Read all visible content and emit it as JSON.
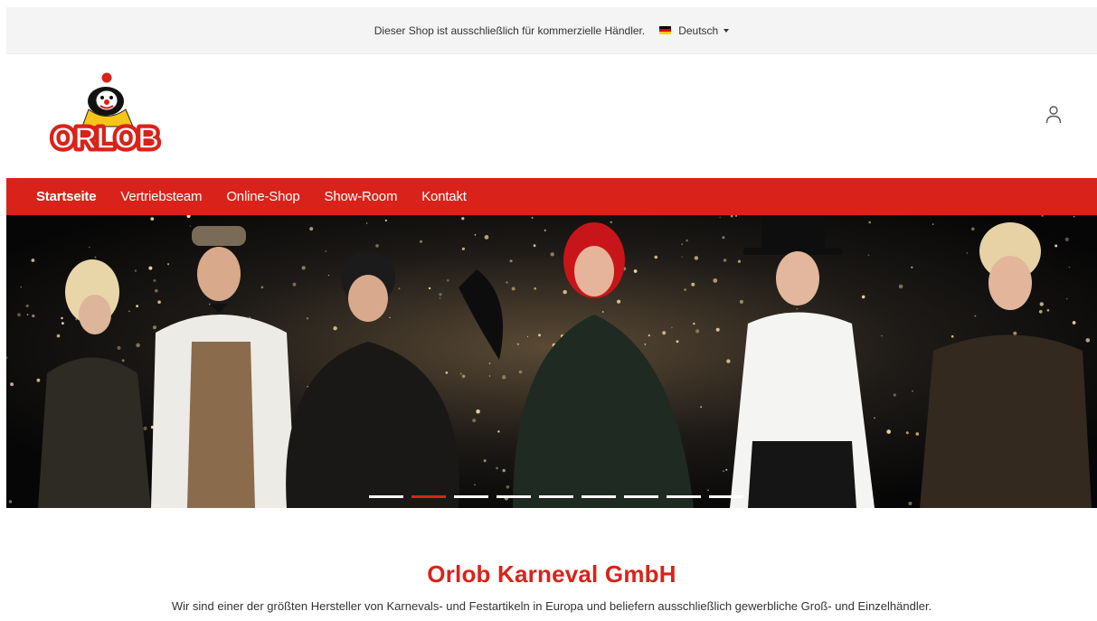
{
  "topbar": {
    "notice": "Dieser Shop ist ausschließlich für kommerzielle Händler.",
    "language": "Deutsch",
    "flag_colors": [
      "#000000",
      "#dd0000",
      "#ffce00"
    ]
  },
  "logo": {
    "text": "ORLOB",
    "icon": "clown-logo-icon"
  },
  "header": {
    "account_icon": "user-account-icon"
  },
  "nav": {
    "items": [
      {
        "label": "Startseite",
        "active": true
      },
      {
        "label": "Vertriebsteam",
        "active": false
      },
      {
        "label": "Online-Shop",
        "active": false
      },
      {
        "label": "Show-Room",
        "active": false
      },
      {
        "label": "Kontakt",
        "active": false
      }
    ]
  },
  "hero": {
    "slide_count": 9,
    "active_slide": 2
  },
  "intro": {
    "title": "Orlob Karneval GmbH",
    "text": "Wir sind einer der größten Hersteller von Karnevals- und Festartikeln in Europa und beliefern ausschließlich gewerbliche Groß- und Einzelhändler."
  },
  "colors": {
    "brand_red": "#d9231a",
    "topbar_bg": "#f4f4f4",
    "text": "#333333"
  }
}
